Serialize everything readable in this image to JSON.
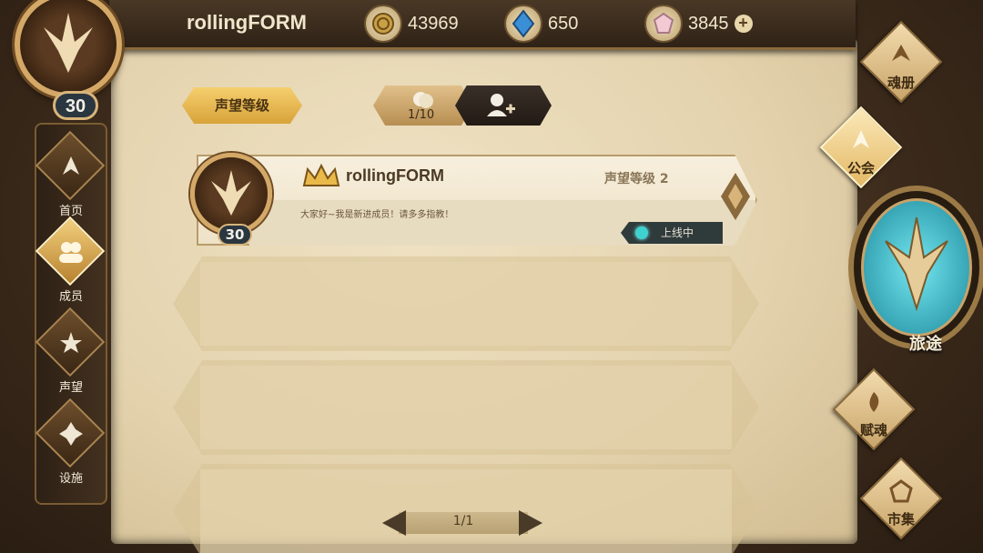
{
  "player": {
    "name": "rollingFORM",
    "level": "30"
  },
  "resources": [
    {
      "icon": "gold-coin-icon",
      "value": "43969"
    },
    {
      "icon": "blue-crystal-icon",
      "value": "650"
    },
    {
      "icon": "pink-gem-icon",
      "value": "3845",
      "plus": "+"
    }
  ],
  "left_nav": [
    {
      "id": "home",
      "label": "首页",
      "icon": "home-icon"
    },
    {
      "id": "members",
      "label": "成员",
      "icon": "members-icon",
      "active": true
    },
    {
      "id": "reputation",
      "label": "声望",
      "icon": "reputation-icon"
    },
    {
      "id": "facilities",
      "label": "设施",
      "icon": "facilities-icon"
    }
  ],
  "tabs": {
    "reputation_level": "声望等级",
    "member_count": "1/10"
  },
  "member": {
    "name": "rollingFORM",
    "level": "30",
    "reputation": "声望等级 2",
    "message": "大家好~我是新进成员！请多多指教！",
    "status": "上线中"
  },
  "pager": {
    "text": "1/1"
  },
  "right_nav": [
    {
      "id": "soul-book",
      "label": "魂册"
    },
    {
      "id": "guild",
      "label": "公会",
      "active": true
    },
    {
      "id": "journey",
      "label": "旅途"
    },
    {
      "id": "endow-soul",
      "label": "赋魂"
    },
    {
      "id": "market",
      "label": "市集"
    }
  ],
  "colors": {
    "accent_gold": "#d8a33a",
    "online": "#3fd0d0",
    "parchment": "#e4d3ae"
  }
}
